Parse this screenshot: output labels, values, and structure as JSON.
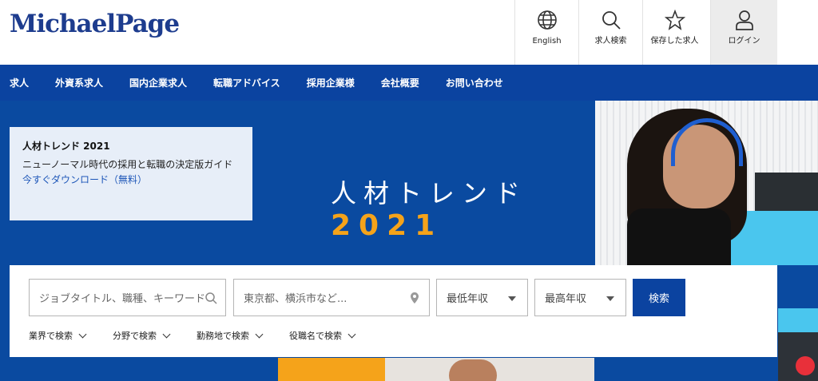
{
  "header": {
    "logo": "MichaelPage",
    "utility": [
      {
        "label": "English",
        "icon": "globe-icon"
      },
      {
        "label": "求人検索",
        "icon": "search-icon"
      },
      {
        "label": "保存した求人",
        "icon": "star-icon"
      },
      {
        "label": "ログイン",
        "icon": "user-icon"
      }
    ]
  },
  "nav": {
    "items": [
      "求人",
      "外資系求人",
      "国内企業求人",
      "転職アドバイス",
      "採用企業様",
      "会社概要",
      "お問い合わせ"
    ]
  },
  "hero": {
    "promo": {
      "title": "人材トレンド 2021",
      "subtitle": "ニューノーマル時代の採用と転職の決定版ガイド",
      "link": "今すぐダウンロード（無料）"
    },
    "headline": "人材トレンド",
    "year": "2021"
  },
  "search": {
    "keyword_placeholder": "ジョブタイトル、職種、キーワード など",
    "location_placeholder": "東京都、横浜市など...",
    "min_salary": "最低年収",
    "max_salary": "最高年収",
    "submit": "検索",
    "filters": [
      "業界で検索",
      "分野で検索",
      "勤務地で検索",
      "役職名で検索"
    ]
  },
  "colors": {
    "brand_blue": "#0b43a0",
    "accent_yellow": "#f5a31a",
    "logo_blue": "#1d3c8e"
  }
}
